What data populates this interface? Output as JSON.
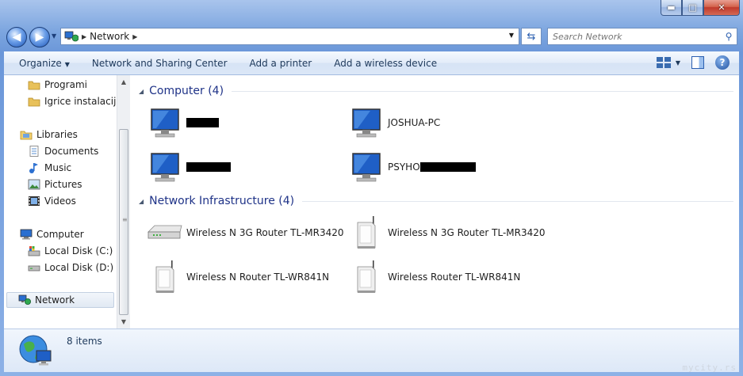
{
  "window": {
    "caption": {
      "minimize": "▬",
      "maximize": "□",
      "close": "✕"
    }
  },
  "address": {
    "breadcrumb": [
      "Network"
    ],
    "search_placeholder": "Search Network"
  },
  "toolbar": {
    "organize": "Organize",
    "items": [
      "Network and Sharing Center",
      "Add a printer",
      "Add a wireless device"
    ],
    "help": "?"
  },
  "navpane": {
    "items": [
      {
        "label": "Programi",
        "icon": "folder-icon"
      },
      {
        "label": "Igrice instalacije",
        "icon": "folder-icon"
      },
      {
        "label": "Libraries",
        "icon": "libraries-icon"
      },
      {
        "label": "Documents",
        "icon": "documents-icon"
      },
      {
        "label": "Music",
        "icon": "music-icon"
      },
      {
        "label": "Pictures",
        "icon": "pictures-icon"
      },
      {
        "label": "Videos",
        "icon": "videos-icon"
      },
      {
        "label": "Computer",
        "icon": "computer-icon"
      },
      {
        "label": "Local Disk (C:)",
        "icon": "local-disk-c-icon"
      },
      {
        "label": "Local Disk (D:)",
        "icon": "local-disk-icon"
      },
      {
        "label": "Network",
        "icon": "network-icon",
        "selected": true
      }
    ]
  },
  "groups": [
    {
      "title": "Computer (4)",
      "items": [
        {
          "label": "",
          "redacted": true,
          "icon": "computer-icon"
        },
        {
          "label": "JOSHUA-PC",
          "icon": "computer-icon"
        },
        {
          "label": "",
          "redacted": true,
          "icon": "computer-icon"
        },
        {
          "label": "PSYHO",
          "redacted": true,
          "icon": "computer-icon"
        }
      ]
    },
    {
      "title": "Network Infrastructure (4)",
      "items": [
        {
          "label": "Wireless N 3G Router TL-MR3420",
          "icon": "router-icon"
        },
        {
          "label": "Wireless N 3G Router TL-MR3420",
          "icon": "router-tower-icon"
        },
        {
          "label": "Wireless N Router TL-WR841N",
          "icon": "router-tower-icon"
        },
        {
          "label": "Wireless Router TL-WR841N",
          "icon": "router-tower-icon"
        }
      ]
    }
  ],
  "details": {
    "count": "8 items"
  },
  "watermark": "mycity.rs"
}
